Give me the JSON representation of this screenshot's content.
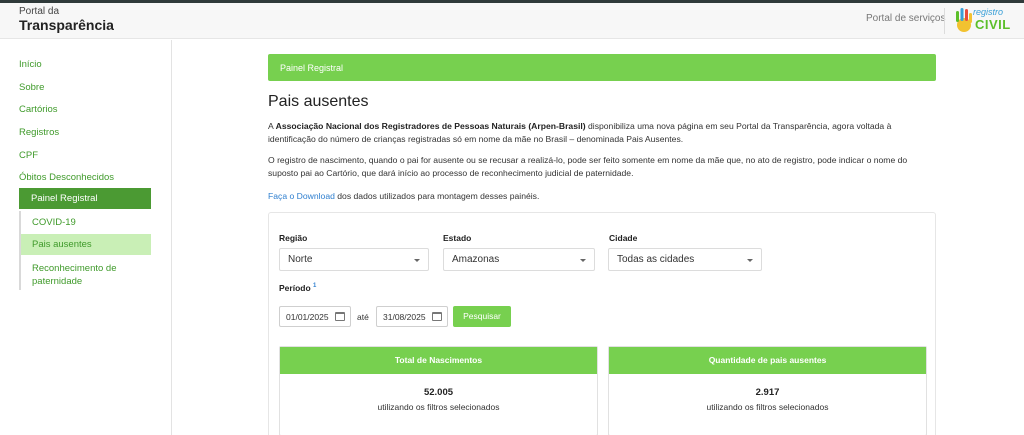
{
  "header": {
    "brand_small": "Portal da",
    "brand_big": "Transparência",
    "portal_servicos": "Portal de serviços",
    "logo_line1": "registro",
    "logo_line2": "CIVIL"
  },
  "sidebar": {
    "items": [
      {
        "label": "Início"
      },
      {
        "label": "Sobre"
      },
      {
        "label": "Cartórios"
      },
      {
        "label": "Registros"
      },
      {
        "label": "CPF"
      },
      {
        "label": "Óbitos Desconhecidos"
      }
    ],
    "active_item": "Painel Registral",
    "sub_items": [
      {
        "label": "COVID-19"
      },
      {
        "label": "Pais ausentes"
      },
      {
        "label": "Reconhecimento de paternidade"
      }
    ]
  },
  "main": {
    "breadcrumb": "Painel Registral",
    "title": "Pais ausentes",
    "p1_before": "A ",
    "p1_bold": "Associação Nacional dos Registradores de Pessoas Naturais (Arpen-Brasil)",
    "p1_after": " disponibiliza uma nova página em seu Portal da Transparência, agora voltada à identificação do número de crianças registradas só em nome da mãe no Brasil – denominada Pais Ausentes.",
    "p2": "O registro de nascimento, quando o pai for ausente ou se recusar a realizá-lo, pode ser feito somente em nome da mãe que, no ato de registro, pode indicar o nome do suposto pai ao Cartório, que dará início ao processo de reconhecimento judicial de paternidade.",
    "p3_link": "Faça o Download",
    "p3_rest": " dos dados utilizados para montagem desses painéis."
  },
  "filters": {
    "regiao_label": "Região",
    "regiao_value": "Norte",
    "estado_label": "Estado",
    "estado_value": "Amazonas",
    "cidade_label": "Cidade",
    "cidade_value": "Todas as cidades",
    "periodo_label": "Período",
    "periodo_sup": "1",
    "date_from": "01/01/2025",
    "ate": "até",
    "date_to": "31/08/2025",
    "search_button": "Pesquisar"
  },
  "stats": [
    {
      "title": "Total de Nascimentos",
      "value": "52.005",
      "subtitle": "utilizando os filtros selecionados"
    },
    {
      "title": "Quantidade de pais ausentes",
      "value": "2.917",
      "subtitle": "utilizando os filtros selecionados"
    }
  ],
  "colors": {
    "accent_green": "#77d04f",
    "dark_green": "#4b9a33",
    "link_blue": "#2f7fcf",
    "nav_green": "#3f9a2a"
  }
}
